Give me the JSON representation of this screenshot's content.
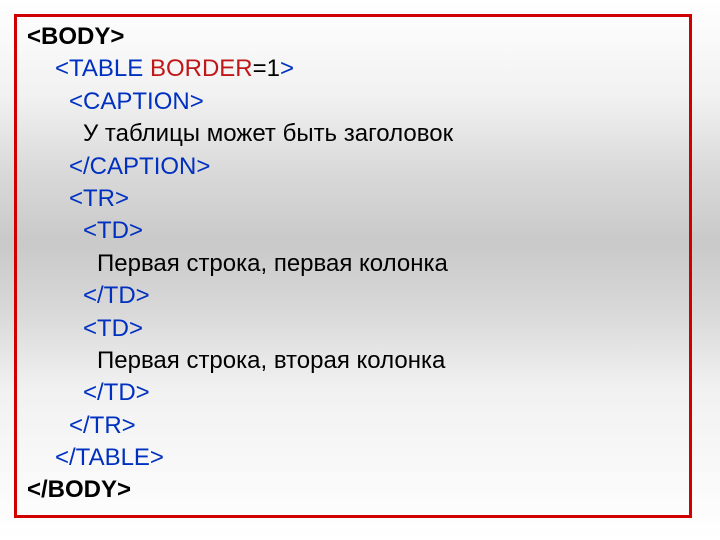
{
  "code": {
    "body_open": "<BODY>",
    "table_open_prefix": "<TABLE ",
    "table_border_attr": "BORDER",
    "table_border_eq": "=",
    "table_border_val": "1",
    "table_open_suffix": ">",
    "caption_open": "<CAPTION>",
    "caption_text": "У таблицы может быть заголовок",
    "caption_close": "</CAPTION>",
    "tr_open": "<TR>",
    "td_open_1": "<TD>",
    "cell1_text": "Первая строка, первая колонка",
    "td_close_1": "</TD>",
    "td_open_2": "<TD>",
    "cell2_text": "Первая строка, вторая колонка",
    "td_close_2": "</TD>",
    "tr_close": "</TR>",
    "table_close": "</TABLE>",
    "body_close": "</BODY>"
  }
}
